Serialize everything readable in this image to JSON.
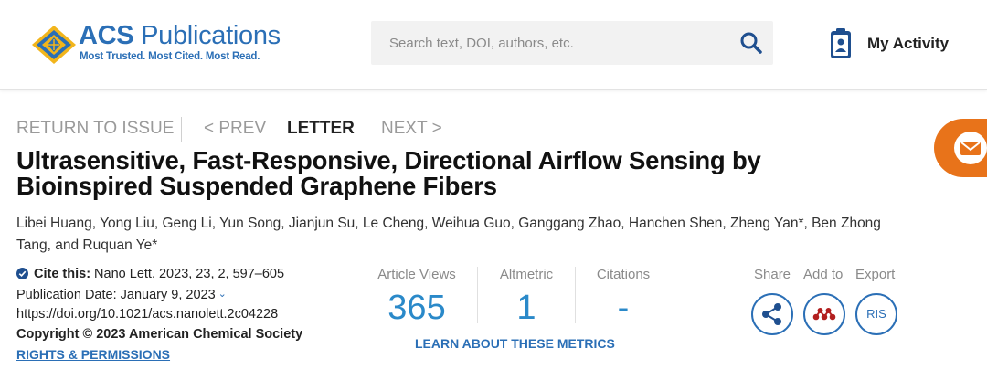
{
  "header": {
    "logo": {
      "title_bold": "ACS",
      "title_rest": " Publications",
      "tagline": "Most Trusted. Most Cited. Most Read.",
      "icon": "acs-diamond-logo-icon",
      "colors": {
        "blue": "#2b6fb6",
        "gold": "#f2b51c"
      }
    },
    "search": {
      "placeholder": "Search text, DOI, authors, etc.",
      "value": "",
      "icon": "search-icon"
    },
    "my_activity": {
      "label": "My Activity",
      "icon": "clipboard-user-icon"
    }
  },
  "email_tab": {
    "icon": "envelope-icon",
    "color": "#e8731a"
  },
  "article_nav": {
    "return_label": "RETURN TO ISSUE",
    "prev_label": "< PREV",
    "current_label": "LETTER",
    "next_label": "NEXT >"
  },
  "article": {
    "title": "Ultrasensitive, Fast-Responsive, Directional Airflow Sensing by Bioinspired Suspended Graphene Fibers",
    "authors": "Libei Huang, Yong Liu, Geng Li, Yun Song, Jianjun Su, Le Cheng, Weihua Guo, Ganggang Zhao, Hanchen Shen, Zheng Yan*, Ben Zhong Tang, and Ruquan Ye*"
  },
  "citation": {
    "cite_label": "Cite this:",
    "cite_value": " Nano Lett.  2023, 23, 2, 597–605",
    "pub_date": "Publication Date: January 9, 2023",
    "doi": "https://doi.org/10.1021/acs.nanolett.2c04228",
    "copyright": "Copyright © 2023 American Chemical Society",
    "rights": "RIGHTS & PERMISSIONS"
  },
  "metrics": {
    "views_label": "Article Views",
    "views_value": "365",
    "altmetric_label": "Altmetric",
    "altmetric_value": "1",
    "citations_label": "Citations",
    "citations_value": "-",
    "learn_more": "LEARN ABOUT THESE METRICS",
    "value_color": "#2a89c9"
  },
  "tools": {
    "share_label": "Share",
    "addto_label": "Add to",
    "export_label": "Export",
    "export_button": "RIS",
    "share_icon": "share-icon",
    "addto_icon": "mendeley-icon",
    "addto_color": "#b21f1f"
  }
}
